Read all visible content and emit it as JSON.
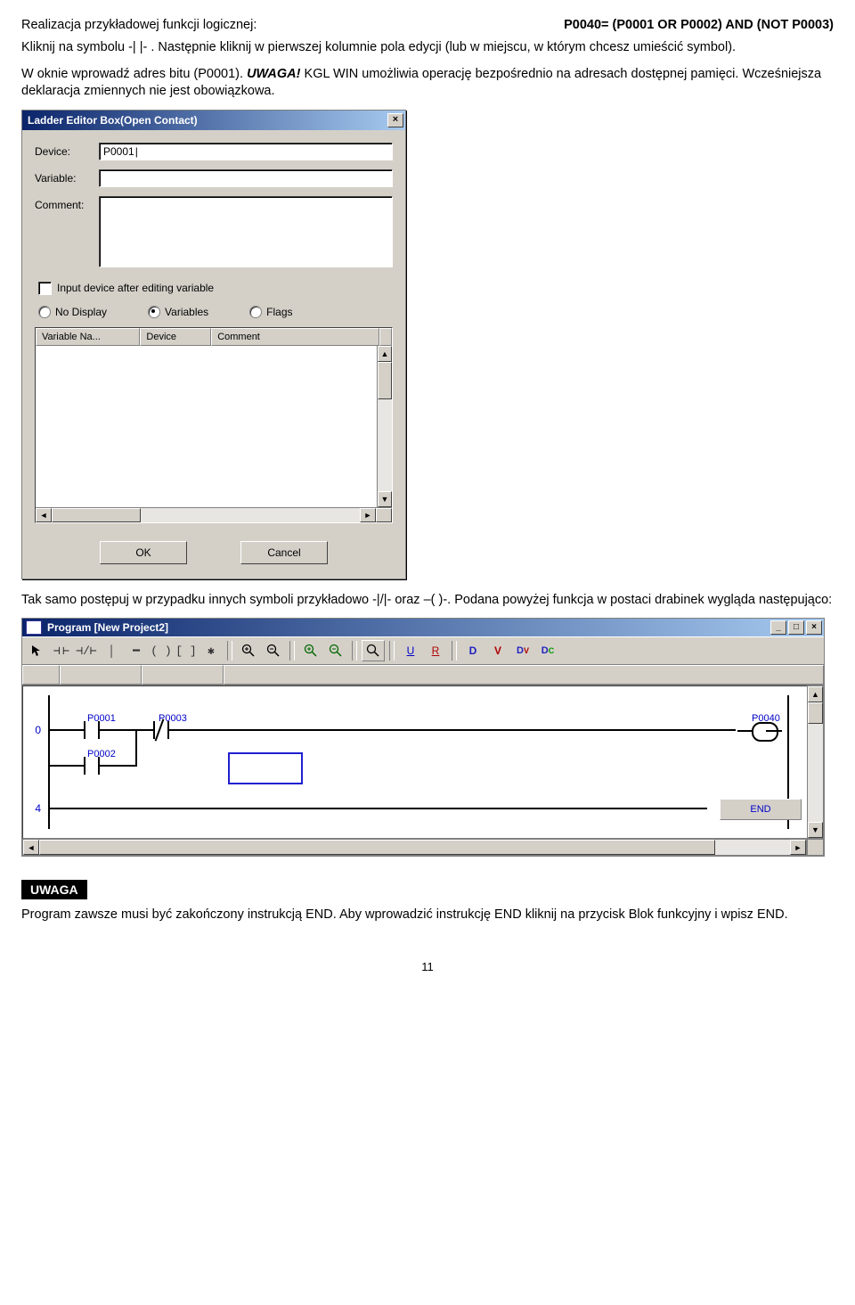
{
  "header": {
    "left": "Realizacja przykładowej funkcji logicznej:",
    "right": "P0040= (P0001 OR P0002) AND (NOT P0003)"
  },
  "para1": "Kliknij na symbolu -| |- . Następnie kliknij w pierwszej kolumnie pola edycji (lub w miejscu, w którym chcesz umieścić symbol).",
  "para2a": "W oknie wprowadź adres bitu (P0001). ",
  "para2b": "UWAGA!",
  "para2c": " KGL WIN umożliwia operację bezpośrednio na adresach dostępnej pamięci. Wcześniejsza deklaracja zmiennych nie jest obowiązkowa.",
  "dialog": {
    "title": "Ladder Editor Box(Open Contact)",
    "close": "×",
    "lbl_device": "Device:",
    "lbl_variable": "Variable:",
    "lbl_comment": "Comment:",
    "device_value": "P0001",
    "cb_label": "Input device after editing variable",
    "radio_nodisplay": "No Display",
    "radio_variables": "Variables",
    "radio_flags": "Flags",
    "col1": "Variable Na...",
    "col2": "Device",
    "col3": "Comment",
    "btn_ok": "OK",
    "btn_cancel": "Cancel"
  },
  "para3": "Tak samo postępuj w przypadku innych symboli przykładowo -|/|- oraz –( )-. Podana powyżej funkcja w postaci drabinek wygląda następująco:",
  "program": {
    "title": "Program [New Project2]",
    "min": "_",
    "max": "□",
    "close": "×",
    "bar_U": "U",
    "bar_R": "R",
    "bar_D": "D",
    "bar_V": "V",
    "bar_Dv": "D",
    "bar_Dc": "D",
    "rung0": "0",
    "rung4": "4",
    "addr_p0001": "P0001",
    "addr_p0002": "P0002",
    "addr_p0003": "P0003",
    "addr_p0040": "P0040",
    "end": "END"
  },
  "badge": "UWAGA",
  "para4": "Program zawsze musi być zakończony instrukcją END. Aby wprowadzić instrukcję END kliknij na przycisk Blok funkcyjny i wpisz END.",
  "pagenum": "11"
}
